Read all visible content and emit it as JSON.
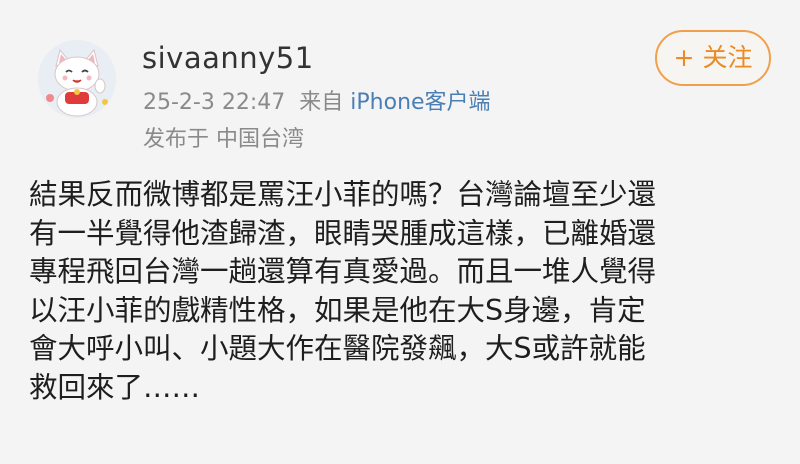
{
  "post": {
    "username": "sivaanny51",
    "timestamp": "25-2-3 22:47",
    "source_prefix": "来自",
    "source_client": "iPhone客户端",
    "location": "发布于 中国台湾",
    "follow_label": "+ 关注",
    "content_lines": [
      "結果反而微博都是罵汪小菲的嗎？台灣論壇至少還",
      "有一半覺得他渣歸渣，眼睛哭腫成這樣，已離婚還",
      "專程飛回台灣一趟還算有真愛過。而且一堆人覺得",
      "以汪小菲的戲精性格，如果是他在大S身邊，肯定",
      "會大呼小叫、小題大作在醫院發飆，大S或許就能",
      "救回來了……"
    ]
  },
  "colors": {
    "accent": "#ee8a25",
    "link": "#4a7fb5",
    "meta": "#8a8a8a",
    "background": "#f4f4f4"
  },
  "icons": {
    "avatar": "lucky-cat-avatar"
  }
}
